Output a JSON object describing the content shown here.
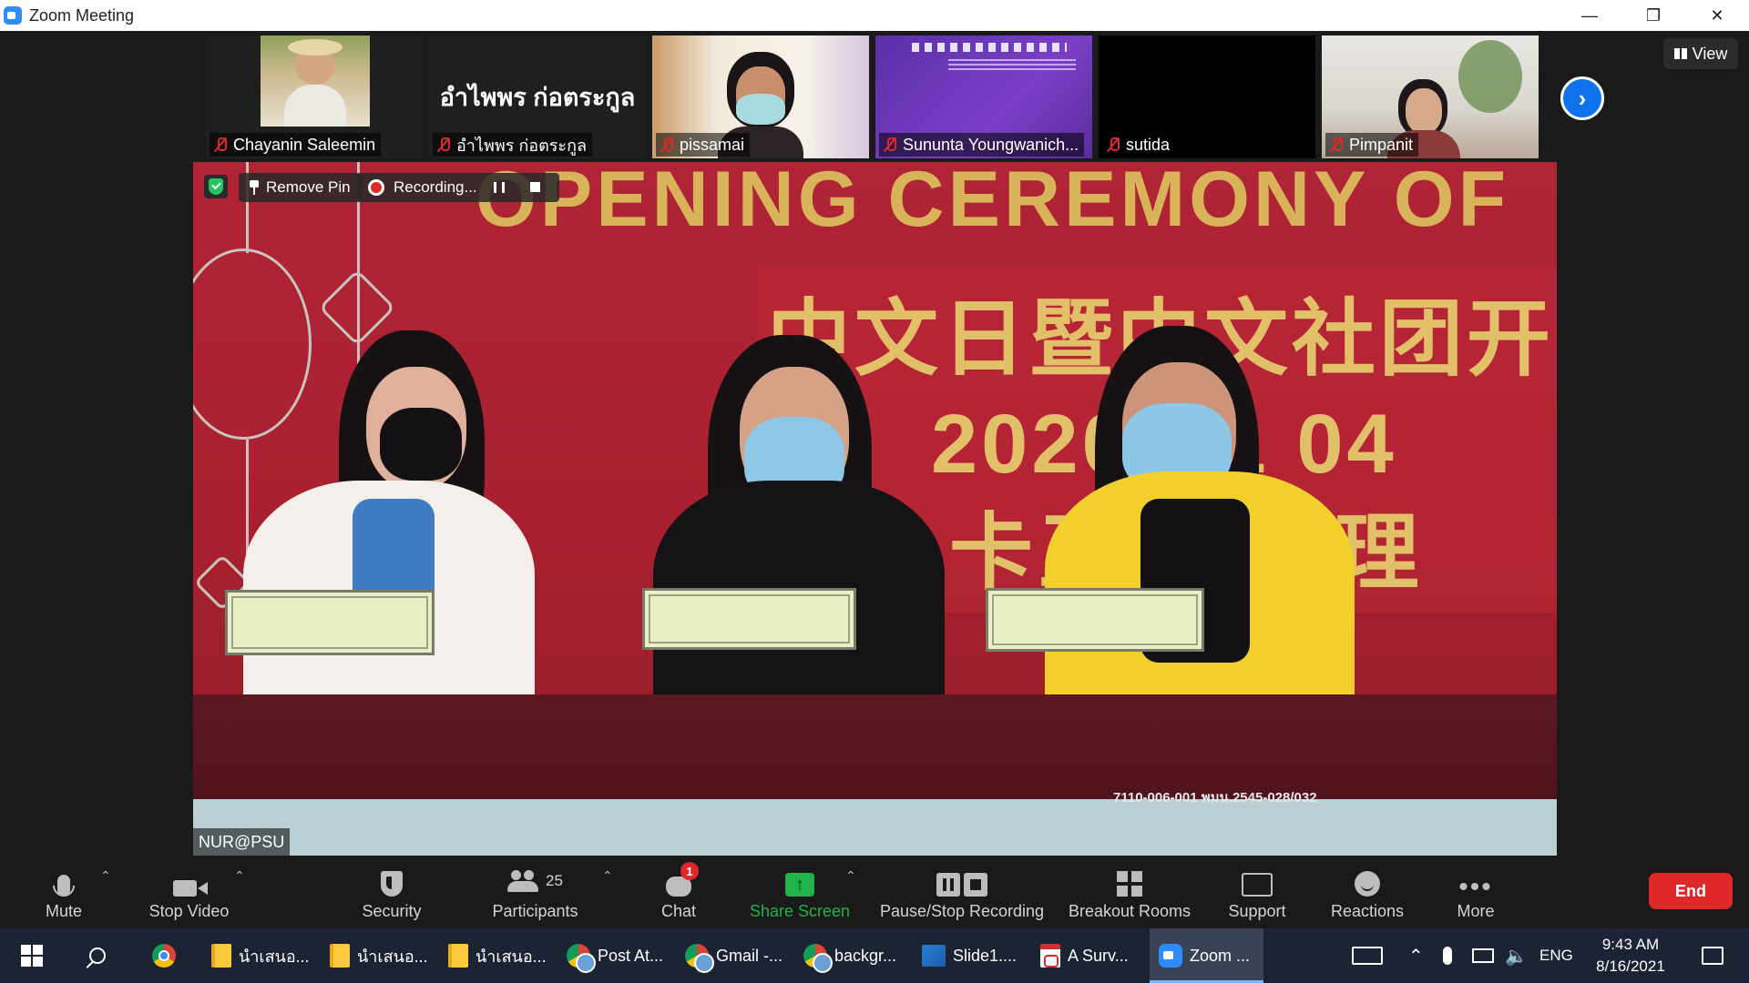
{
  "window": {
    "title": "Zoom Meeting",
    "minimize": "—",
    "maximize": "❐",
    "close": "✕"
  },
  "filmstrip": {
    "participants": [
      {
        "name": "Chayanin Saleemin",
        "muted": true
      },
      {
        "name": "อำไพพร ก่อตระกูล",
        "muted": true,
        "big_name": "อำไพพร ก่อตระกูล"
      },
      {
        "name": "pissamai",
        "muted": true
      },
      {
        "name": "Sununta Youngwanich...",
        "muted": true
      },
      {
        "name": "sutida",
        "muted": true
      },
      {
        "name": "Pimpanit",
        "muted": true
      }
    ],
    "next_icon": "chevron-right-icon",
    "view_label": "View"
  },
  "main_video": {
    "remove_pin_label": "Remove Pin",
    "recording_label": "Recording...",
    "participant_label": "NUR@PSU",
    "banner_title": "OPENING CEREMONY OF",
    "banner_cn_line1": "中文日暨中文社团开",
    "banner_cn_line2": "2020年1  04",
    "banner_cn_line3": "卡王子大  理",
    "table_code": "7110-006-001   พมน.2545-028/032"
  },
  "toolbar": {
    "mute": "Mute",
    "stop_video": "Stop Video",
    "security": "Security",
    "participants": "Participants",
    "participant_count": "25",
    "chat": "Chat",
    "chat_badge": "1",
    "share_screen": "Share Screen",
    "pause_stop_recording": "Pause/Stop Recording",
    "breakout_rooms": "Breakout Rooms",
    "support": "Support",
    "reactions": "Reactions",
    "more": "More",
    "end": "End",
    "colors": {
      "end": "#e02828",
      "share": "#22b24c",
      "accent": "#0e72ed"
    }
  },
  "taskbar": {
    "apps": [
      {
        "label": "นำเสนอ...",
        "icon": "folder-icon"
      },
      {
        "label": "นำเสนอ...",
        "icon": "folder-icon"
      },
      {
        "label": "นำเสนอ...",
        "icon": "folder-icon"
      },
      {
        "label": "Post At...",
        "icon": "chrome-icon"
      },
      {
        "label": "Gmail -...",
        "icon": "chrome-icon"
      },
      {
        "label": "backgr...",
        "icon": "chrome-icon"
      },
      {
        "label": "Slide1....",
        "icon": "image-icon"
      },
      {
        "label": "A Surv...",
        "icon": "pdf-icon"
      },
      {
        "label": "Zoom ...",
        "icon": "zoom-icon"
      }
    ],
    "language": "ENG",
    "time": "9:43 AM",
    "date": "8/16/2021"
  }
}
